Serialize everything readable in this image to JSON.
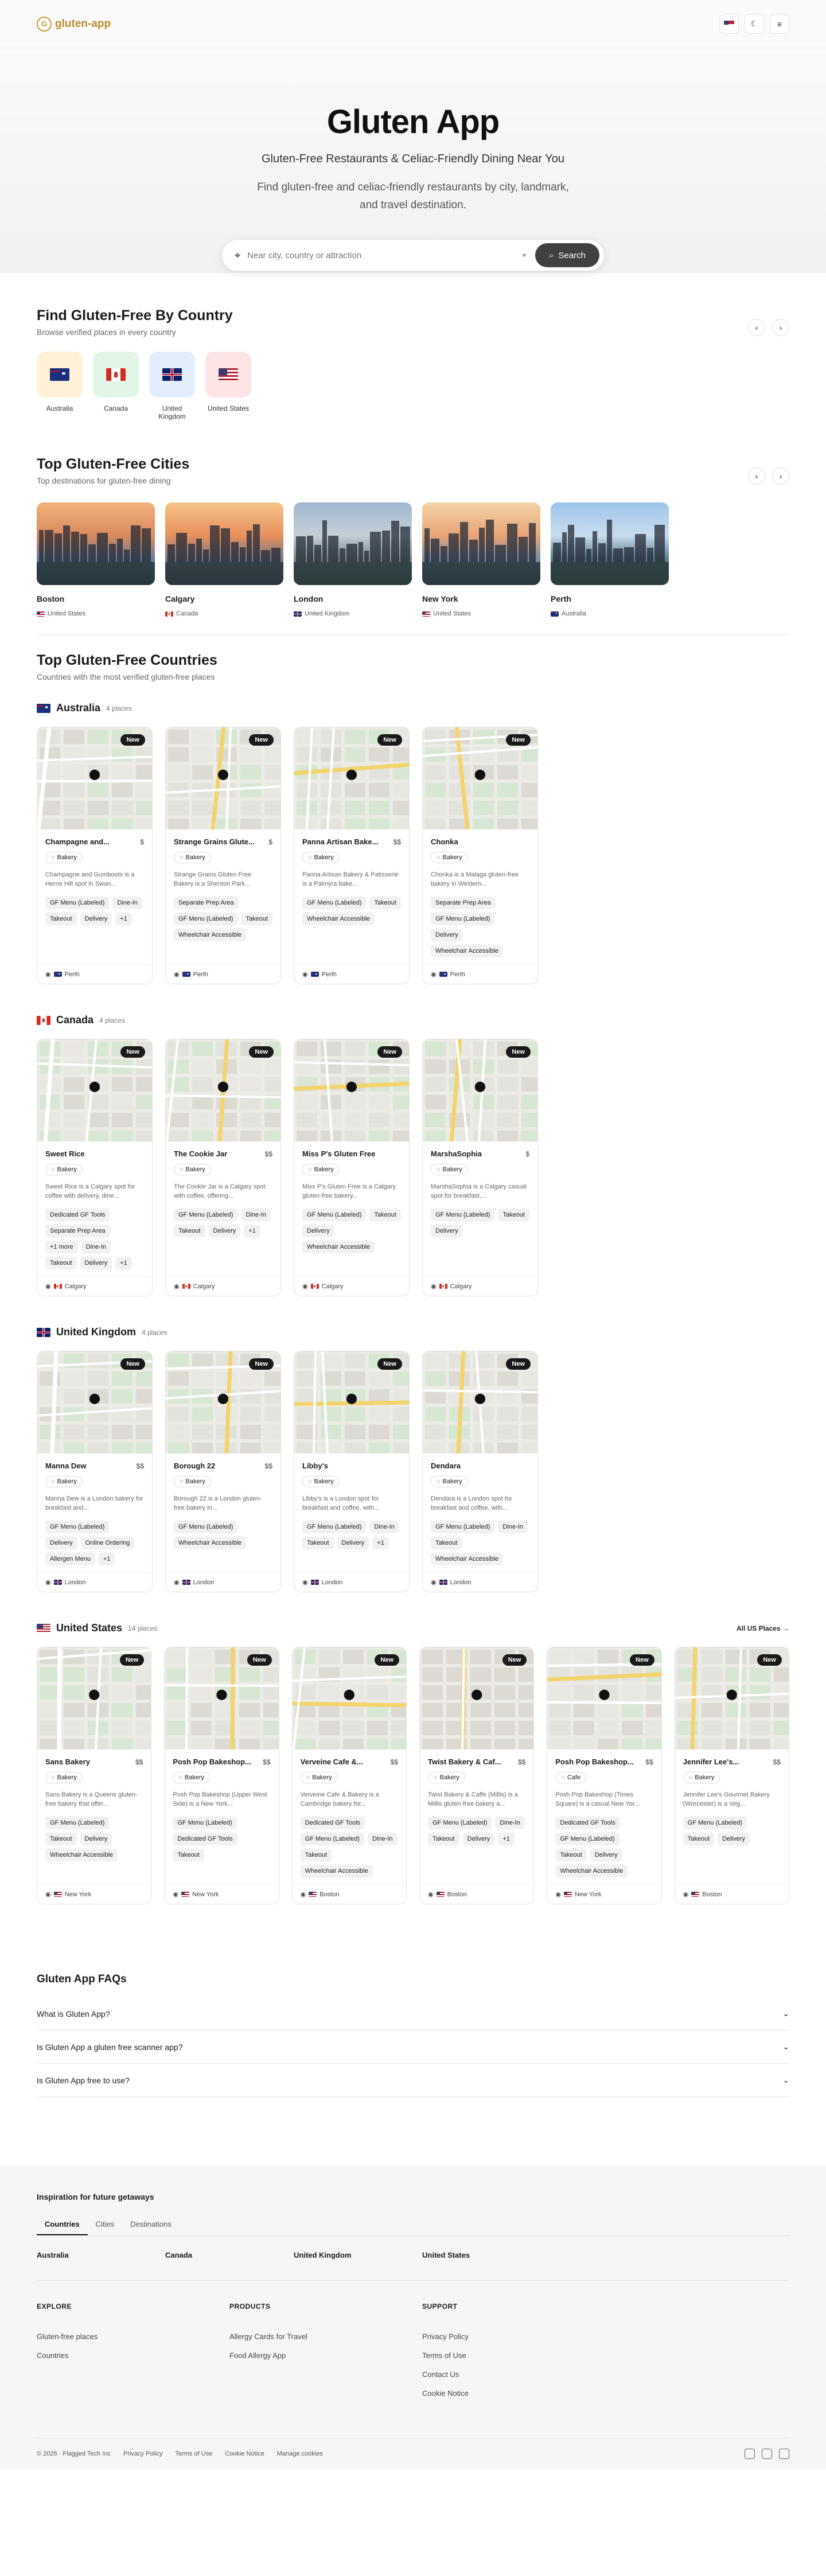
{
  "header": {
    "logo_text": "gluten-app",
    "theme_icon": "moon-icon",
    "menu_icon": "menu-icon"
  },
  "hero": {
    "title": "Gluten App",
    "subtitle": "Gluten-Free Restaurants & Celiac-Friendly Dining Near You",
    "description": "Find gluten-free and celiac-friendly restaurants by city, landmark, and travel destination.",
    "search_placeholder": "Near city, country or attraction",
    "search_button": "Search"
  },
  "by_country": {
    "title": "Find Gluten-Free By Country",
    "subtitle": "Browse verified places in every country",
    "items": [
      {
        "label": "Australia",
        "flag": "au",
        "bg": "#fdf1d8"
      },
      {
        "label": "Canada",
        "flag": "ca",
        "bg": "#e3f5e6"
      },
      {
        "label": "United Kingdom",
        "flag": "uk",
        "bg": "#e2eefb"
      },
      {
        "label": "United States",
        "flag": "us",
        "bg": "#fde5e6"
      }
    ]
  },
  "top_cities": {
    "title": "Top Gluten-Free Cities",
    "subtitle": "Top destinations for gluten-free dining",
    "items": [
      {
        "name": "Boston",
        "country": "United States",
        "flag": "us"
      },
      {
        "name": "Calgary",
        "country": "Canada",
        "flag": "ca"
      },
      {
        "name": "London",
        "country": "United Kingdom",
        "flag": "uk"
      },
      {
        "name": "New York",
        "country": "United States",
        "flag": "us"
      },
      {
        "name": "Perth",
        "country": "Australia",
        "flag": "au"
      }
    ]
  },
  "top_countries": {
    "title": "Top Gluten-Free Countries",
    "subtitle": "Countries with the most verified gluten-free places",
    "new_badge": "New",
    "blocks": [
      {
        "name": "Australia",
        "count": "4 places",
        "flag": "au",
        "all_link": "",
        "cards": [
          {
            "title": "Champagne and...",
            "price": "$",
            "category": "Bakery",
            "desc": "Champagne and Gumboots is a Herne Hill spot in Swan...",
            "tags": [
              "GF Menu (Labeled)",
              "Dine-In",
              "Takeout",
              "Delivery",
              "+1"
            ],
            "city": "Perth",
            "flag": "au"
          },
          {
            "title": "Strange Grains Glute...",
            "price": "$",
            "category": "Bakery",
            "desc": "Strange Grains Gluten Free Bakery is a Shenton Park...",
            "tags": [
              "Separate Prep Area",
              "GF Menu (Labeled)",
              "Takeout",
              "Wheelchair Accessible"
            ],
            "city": "Perth",
            "flag": "au"
          },
          {
            "title": "Panna Artisan Bake...",
            "price": "$$",
            "category": "Bakery",
            "desc": "Panna Artisan Bakery & Patisserie is a Palmyra bake...",
            "tags": [
              "GF Menu (Labeled)",
              "Takeout",
              "Wheelchair Accessible"
            ],
            "city": "Perth",
            "flag": "au"
          },
          {
            "title": "Chonka",
            "price": "",
            "category": "Bakery",
            "desc": "Chonka is a Malaga gluten-free bakery in Western...",
            "tags": [
              "Separate Prep Area",
              "GF Menu (Labeled)",
              "Delivery",
              "Wheelchair Accessible"
            ],
            "city": "Perth",
            "flag": "au"
          }
        ]
      },
      {
        "name": "Canada",
        "count": "4 places",
        "flag": "ca",
        "all_link": "",
        "cards": [
          {
            "title": "Sweet Rice",
            "price": "",
            "category": "Bakery",
            "desc": "Sweet Rice is a Calgary spot for coffee with delivery, dine...",
            "tags": [
              "Dedicated GF Tools",
              "Separate Prep Area",
              "+1 more",
              "Dine-In",
              "Takeout",
              "Delivery",
              "+1"
            ],
            "city": "Calgary",
            "flag": "ca"
          },
          {
            "title": "The Cookie Jar",
            "price": "$$",
            "category": "Bakery",
            "desc": "The Cookie Jar is a Calgary spot with coffee, offering...",
            "tags": [
              "GF Menu (Labeled)",
              "Dine-In",
              "Takeout",
              "Delivery",
              "+1"
            ],
            "city": "Calgary",
            "flag": "ca"
          },
          {
            "title": "Miss P's Gluten Free",
            "price": "",
            "category": "Bakery",
            "desc": "Miss P's Gluten Free is a Calgary gluten-free bakery...",
            "tags": [
              "GF Menu (Labeled)",
              "Takeout",
              "Delivery",
              "Wheelchair Accessible"
            ],
            "city": "Calgary",
            "flag": "ca"
          },
          {
            "title": "MarshaSophia",
            "price": "$",
            "category": "Bakery",
            "desc": "MarshaSophia is a Calgary casual spot for breakfast,...",
            "tags": [
              "GF Menu (Labeled)",
              "Takeout",
              "Delivery"
            ],
            "city": "Calgary",
            "flag": "ca"
          }
        ]
      },
      {
        "name": "United Kingdom",
        "count": "4 places",
        "flag": "uk",
        "all_link": "",
        "cards": [
          {
            "title": "Manna Dew",
            "price": "$$",
            "category": "Bakery",
            "desc": "Manna Dew is a London bakery for breakfast and...",
            "tags": [
              "GF Menu (Labeled)",
              "Delivery",
              "Online Ordering",
              "Allergen Menu",
              "+1"
            ],
            "city": "London",
            "flag": "uk"
          },
          {
            "title": "Borough 22",
            "price": "$$",
            "category": "Bakery",
            "desc": "Borough 22 is a London gluten-free bakery in...",
            "tags": [
              "GF Menu (Labeled)",
              "Wheelchair Accessible"
            ],
            "city": "London",
            "flag": "uk"
          },
          {
            "title": "Libby's",
            "price": "",
            "category": "Bakery",
            "desc": "Libby's is a London spot for breakfast and coffee, with...",
            "tags": [
              "GF Menu (Labeled)",
              "Dine-In",
              "Takeout",
              "Delivery",
              "+1"
            ],
            "city": "London",
            "flag": "uk"
          },
          {
            "title": "Dendara",
            "price": "",
            "category": "Bakery",
            "desc": "Dendara is a London spot for breakfast and coffee, with...",
            "tags": [
              "GF Menu (Labeled)",
              "Dine-In",
              "Takeout",
              "Wheelchair Accessible"
            ],
            "city": "London",
            "flag": "uk"
          }
        ]
      },
      {
        "name": "United States",
        "count": "14 places",
        "flag": "us",
        "all_link": "All US Places →",
        "cards": [
          {
            "title": "Sans Bakery",
            "price": "$$",
            "category": "Bakery",
            "desc": "Sans Bakery is a Queens gluten-free bakery that offer...",
            "tags": [
              "GF Menu (Labeled)",
              "Takeout",
              "Delivery",
              "Wheelchair Accessible"
            ],
            "city": "New York",
            "flag": "us"
          },
          {
            "title": "Posh Pop Bakeshop...",
            "price": "$$",
            "category": "Bakery",
            "desc": "Posh Pop Bakeshop (Upper West Side) is a New York...",
            "tags": [
              "GF Menu (Labeled)",
              "Dedicated GF Tools",
              "Takeout"
            ],
            "city": "New York",
            "flag": "us"
          },
          {
            "title": "Verveine Cafe &...",
            "price": "$$",
            "category": "Bakery",
            "desc": "Verveine Cafe & Bakery is a Cambridge bakery for...",
            "tags": [
              "Dedicated GF Tools",
              "GF Menu (Labeled)",
              "Dine-In",
              "Takeout",
              "Wheelchair Accessible"
            ],
            "city": "Boston",
            "flag": "us"
          },
          {
            "title": "Twist Bakery & Caf...",
            "price": "$$",
            "category": "Bakery",
            "desc": "Twist Bakery & Caffe (Millis) is a Millis gluten-free bakery a...",
            "tags": [
              "GF Menu (Labeled)",
              "Dine-In",
              "Takeout",
              "Delivery",
              "+1"
            ],
            "city": "Boston",
            "flag": "us"
          },
          {
            "title": "Posh Pop Bakeshop...",
            "price": "$$",
            "category": "Cafe",
            "desc": "Posh Pop Bakeshop (Times Square) is a casual New Yor...",
            "tags": [
              "Dedicated GF Tools",
              "GF Menu (Labeled)",
              "Takeout",
              "Delivery",
              "Wheelchair Accessible"
            ],
            "city": "New York",
            "flag": "us"
          },
          {
            "title": "Jennifer Lee's...",
            "price": "$$",
            "category": "Bakery",
            "desc": "Jennifer Lee's Gourmet Bakery (Worcester) is a Veg...",
            "tags": [
              "GF Menu (Labeled)",
              "Takeout",
              "Delivery"
            ],
            "city": "Boston",
            "flag": "us"
          }
        ]
      }
    ]
  },
  "faq": {
    "title": "Gluten App FAQs",
    "items": [
      "What is Gluten App?",
      "Is Gluten App a gluten free scanner app?",
      "Is Gluten App free to use?"
    ]
  },
  "footer": {
    "inspiration_title": "Inspiration for future getaways",
    "tabs": [
      "Countries",
      "Cities",
      "Destinations"
    ],
    "tab_items": [
      "Australia",
      "Canada",
      "United Kingdom",
      "United States"
    ],
    "columns": [
      {
        "heading": "EXPLORE",
        "links": [
          "Gluten-free places",
          "Countries"
        ]
      },
      {
        "heading": "PRODUCTS",
        "links": [
          "Allergy Cards for Travel",
          "Food Allergy App"
        ]
      },
      {
        "heading": "SUPPORT",
        "links": [
          "Privacy Policy",
          "Terms of Use",
          "Contact Us",
          "Cookie Notice"
        ]
      }
    ],
    "copyright": "© 2026 · Flagged Tech Inc",
    "bottom_links": [
      "Privacy Policy",
      "Terms of Use",
      "Cookie Notice",
      "Manage cookies"
    ]
  }
}
